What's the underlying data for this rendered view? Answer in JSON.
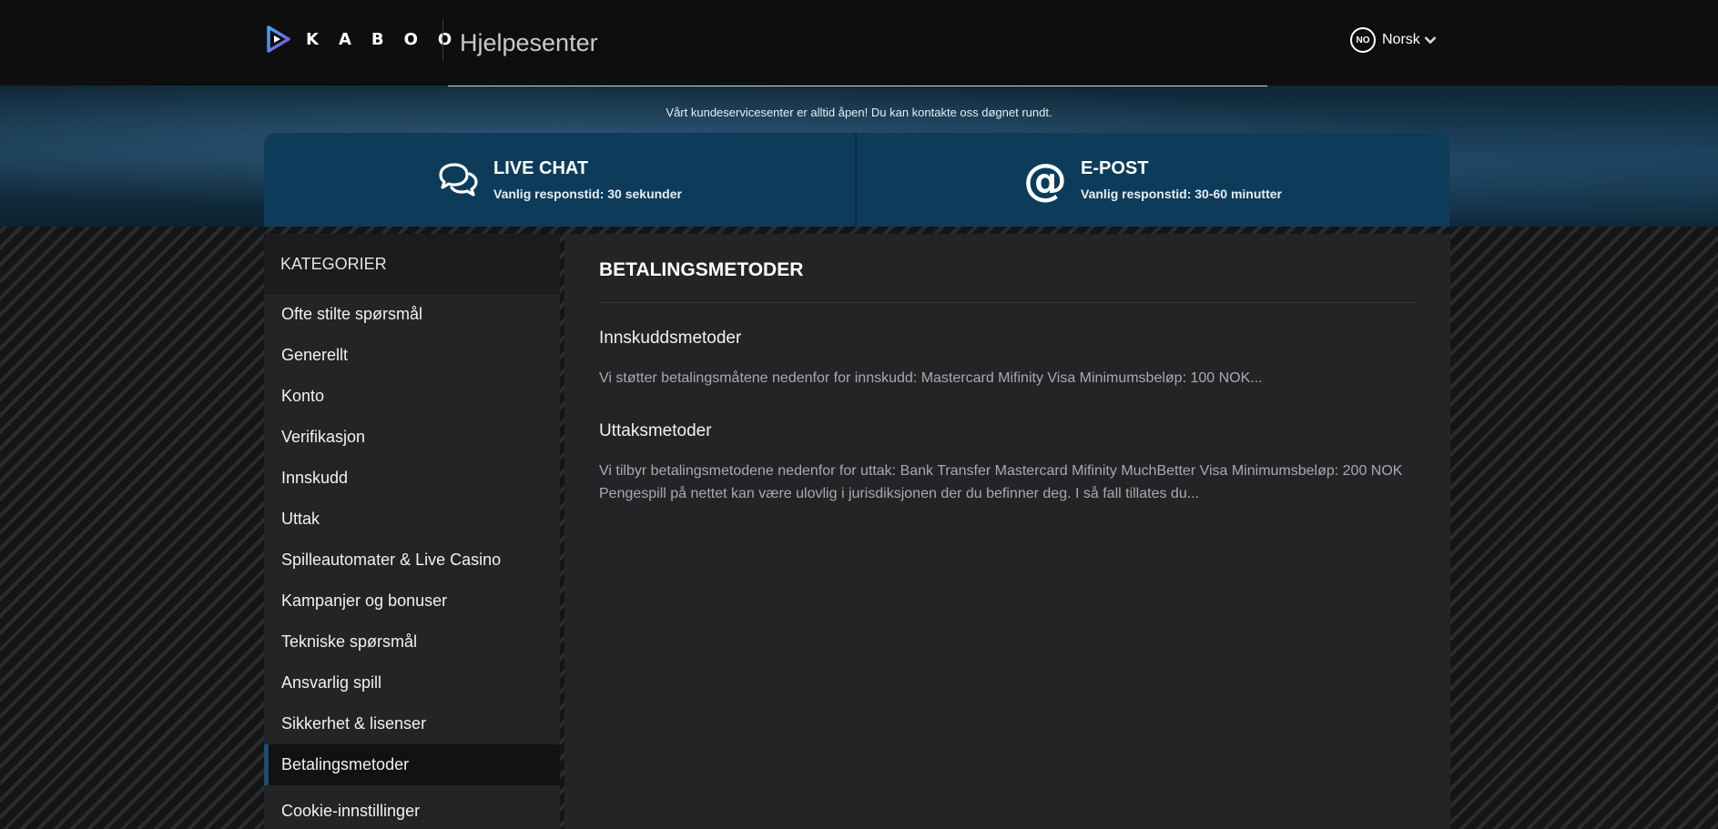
{
  "header": {
    "brand": "KABOO",
    "title": "Hjelpesenter",
    "lang_code": "NO",
    "lang_label": "Norsk"
  },
  "hero": {
    "note": "Vårt kundeservicesenter er alltid åpen! Du kan kontakte oss døgnet rundt."
  },
  "contact": {
    "chat": {
      "title": "LIVE CHAT",
      "sub": "Vanlig responstid: 30 sekunder",
      "icon": "chat-bubbles-icon"
    },
    "email": {
      "title": "E-POST",
      "sub": "Vanlig responstid: 30-60 minutter",
      "icon": "at-sign-icon",
      "glyph": "@"
    }
  },
  "sidebar": {
    "heading": "KATEGORIER",
    "items": [
      {
        "label": "Ofte stilte spørsmål"
      },
      {
        "label": "Generellt"
      },
      {
        "label": "Konto"
      },
      {
        "label": "Verifikasjon"
      },
      {
        "label": "Innskudd"
      },
      {
        "label": "Uttak"
      },
      {
        "label": "Spilleautomater & Live Casino"
      },
      {
        "label": "Kampanjer og bonuser"
      },
      {
        "label": "Tekniske spørsmål"
      },
      {
        "label": "Ansvarlig spill"
      },
      {
        "label": "Sikkerhet & lisenser"
      },
      {
        "label": "Betalingsmetoder",
        "active": true
      },
      {
        "label": "Cookie-innstillinger"
      }
    ]
  },
  "main": {
    "title": "BETALINGSMETODER",
    "sections": [
      {
        "title": "Innskuddsmetoder",
        "text": "Vi støtter betalingsmåtene nedenfor for innskudd: Mastercard Mifinity Visa Minimumsbeløp: 100 NOK..."
      },
      {
        "title": "Uttaksmetoder",
        "text": "Vi tilbyr betalingsmetodene nedenfor for uttak:   Bank Transfer Mastercard Mifinity MuchBetter Visa Minimumsbeløp: 200 NOK     Pengespill på nettet kan være ulovlig i jurisdiksjonen der du befinner deg. I så fall tillates du..."
      }
    ]
  },
  "colors": {
    "header_bg": "#0e0e0e",
    "card_bg": "#0d3c5b",
    "panel_bg": "#222426",
    "active_accent": "#1a4e72",
    "muted_text": "#a8abae"
  }
}
